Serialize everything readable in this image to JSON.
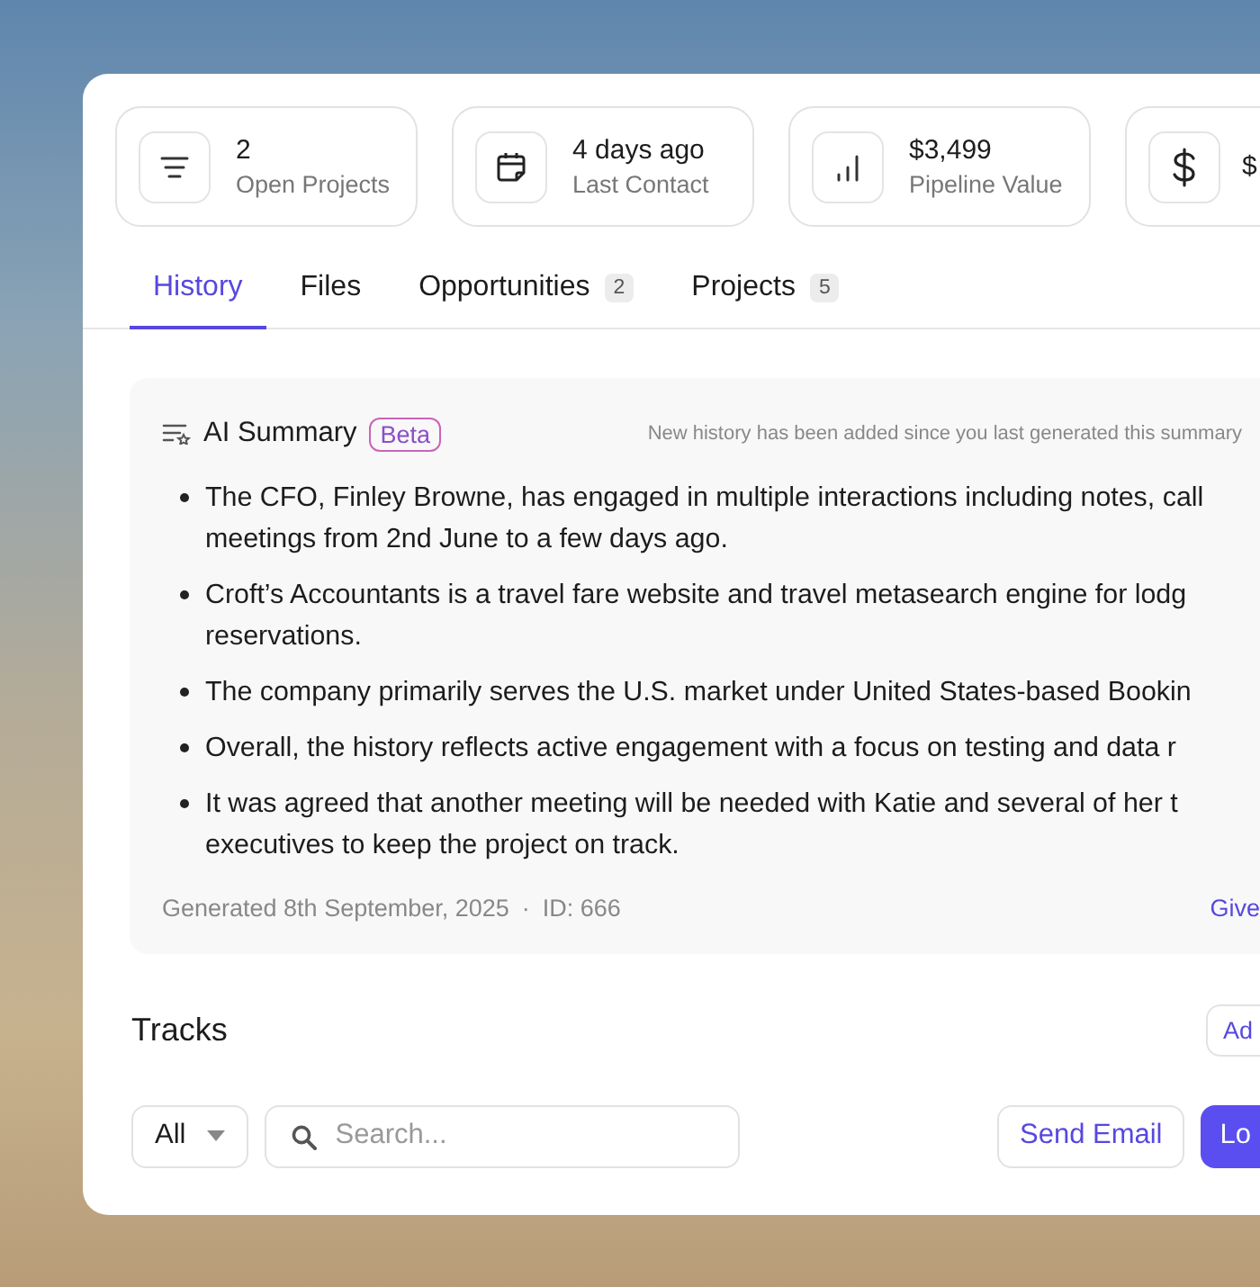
{
  "stats": [
    {
      "kind": "lines",
      "value": "2",
      "label": "Open Projects"
    },
    {
      "kind": "calendar",
      "value": "4 days ago",
      "label": "Last Contact"
    },
    {
      "kind": "bars",
      "value": "$3,499",
      "label": "Pipeline Value"
    },
    {
      "kind": "dollar",
      "value": "$"
    }
  ],
  "tabs": [
    {
      "label": "History",
      "selected": true
    },
    {
      "label": "Files",
      "selected": false
    },
    {
      "label": "Opportunities",
      "count": "2",
      "selected": false
    },
    {
      "label": "Projects",
      "count": "5",
      "selected": false
    }
  ],
  "summary": {
    "title": "AI Summary",
    "badge": "Beta",
    "notice": "New history has been added since you last generated this summary",
    "bullets": [
      {
        "lines": [
          "The CFO, Finley Browne, has engaged in multiple interactions including notes, call",
          "meetings from 2nd June to a few days ago."
        ]
      },
      {
        "lines": [
          "Croft’s Accountants is a travel fare website and travel metasearch engine for lodg",
          "reservations."
        ]
      },
      {
        "lines": [
          "The company primarily serves the U.S. market under United States-based Bookin"
        ]
      },
      {
        "lines": [
          "Overall, the history reflects active engagement with a focus on testing and data r"
        ]
      },
      {
        "lines": [
          "It was agreed that another meeting will be needed with Katie and several of her t",
          "executives to keep the project on track."
        ]
      }
    ],
    "generated": "Generated 8th September, 2025",
    "separator": "·",
    "id": "ID: 666",
    "link": "Give"
  },
  "tracks": {
    "title": "Tracks",
    "add_button": "Ad",
    "filter": "All",
    "search": {
      "placeholder": "Search..."
    },
    "send_email": "Send Email",
    "primary_button": "Lo"
  }
}
